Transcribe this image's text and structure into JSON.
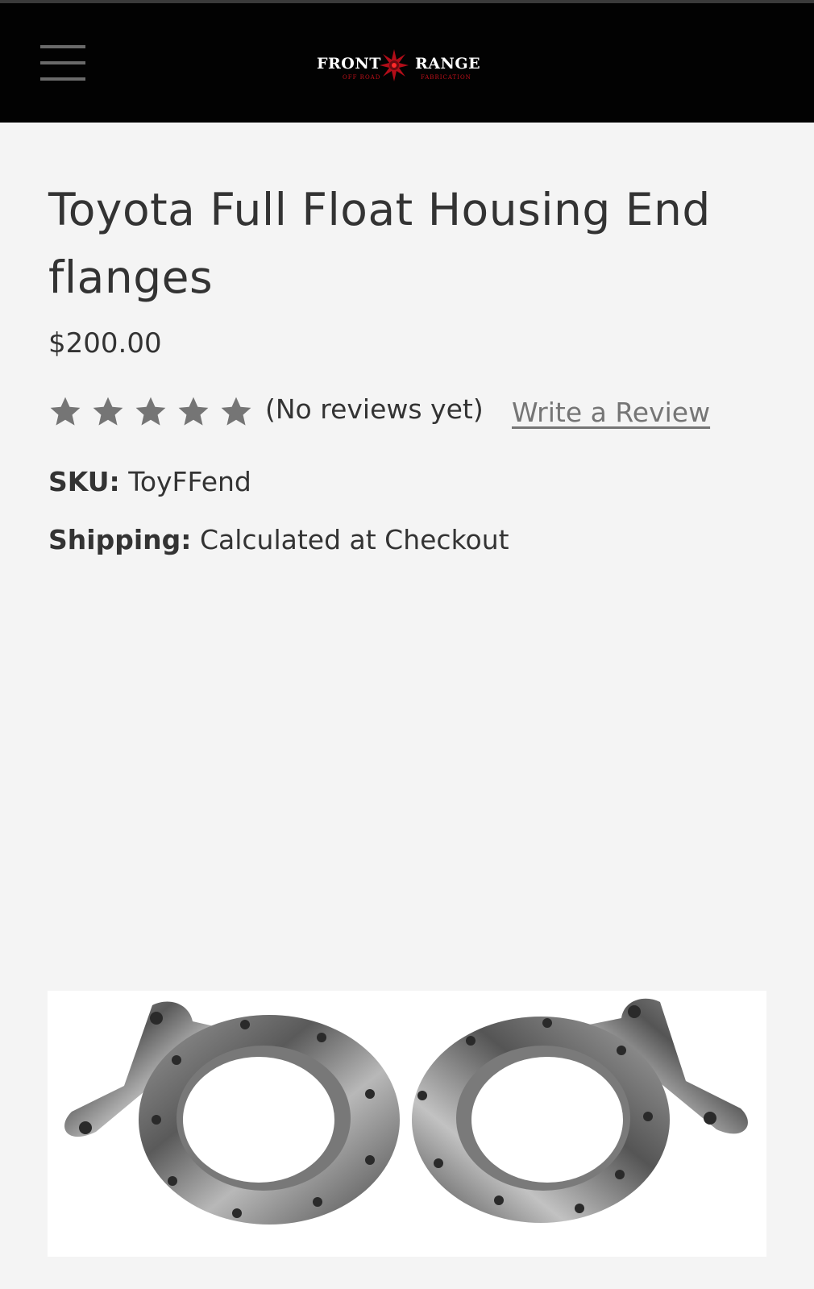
{
  "header": {
    "menu_icon": "hamburger-menu-icon",
    "logo": {
      "left_word": "FRONT",
      "right_word": "RANGE",
      "left_sub": "OFF ROAD",
      "right_sub": "FABRICATION",
      "star_color": "#c0101a"
    }
  },
  "product": {
    "title": "Toyota Full Float Housing End flanges",
    "price": "$200.00",
    "rating": {
      "stars": 5,
      "star_color": "#757575",
      "reviews_text": "(No reviews yet)",
      "write_review_label": "Write a Review"
    },
    "sku_label": "SKU:",
    "sku_value": "ToyFFend",
    "shipping_label": "Shipping:",
    "shipping_value": "Calculated at Checkout",
    "image_icon": "flange-product-image"
  }
}
